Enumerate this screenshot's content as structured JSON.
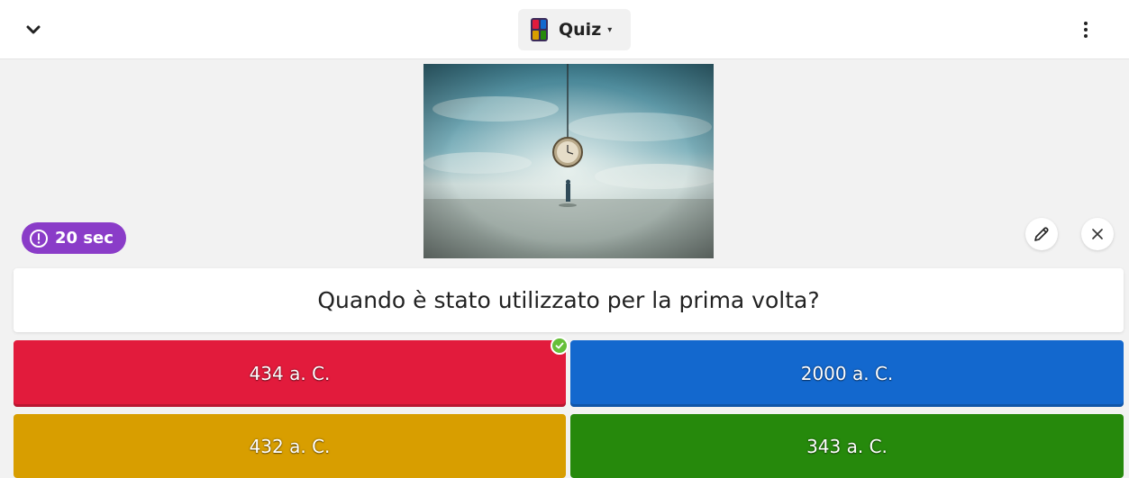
{
  "header": {
    "title": "Quiz",
    "dropdown_caret": "▾"
  },
  "timer": {
    "label": "20 sec"
  },
  "question": {
    "text": "Quando è stato utilizzato per la prima volta?"
  },
  "answers": [
    {
      "text": "434 a. C.",
      "color": "#e21b3c",
      "correct": true
    },
    {
      "text": "2000 a. C.",
      "color": "#1368ce",
      "correct": false
    },
    {
      "text": "432 a. C.",
      "color": "#d89e00",
      "correct": false
    },
    {
      "text": "343 a. C.",
      "color": "#26890c",
      "correct": false
    }
  ],
  "colors": {
    "timer_badge": "#8a3cc8",
    "correct_check": "#66bf39",
    "page_background": "#f2f2f2"
  },
  "icons": {
    "collapse": "chevron-down-icon",
    "menu": "more-vertical-icon",
    "timer": "clock-icon",
    "edit": "pencil-icon",
    "close": "close-icon",
    "correct": "check-circle-icon"
  }
}
